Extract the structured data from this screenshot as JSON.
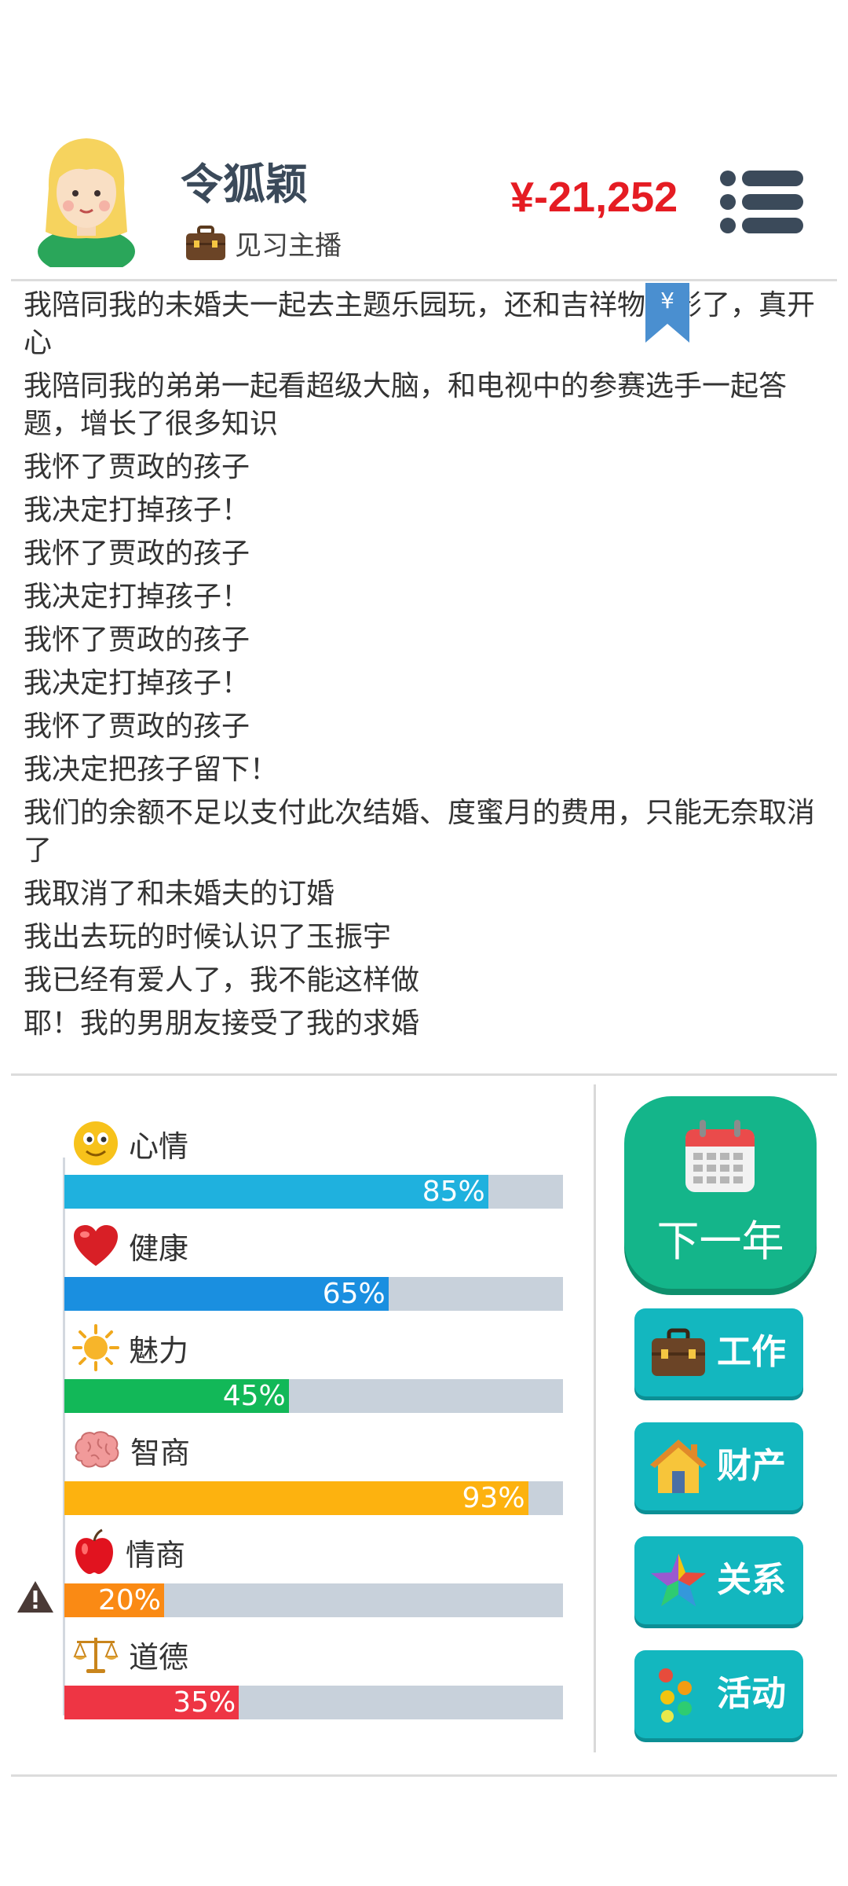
{
  "header": {
    "name": "令狐颖",
    "job": "见习主播",
    "money": "¥-21,252"
  },
  "log": [
    "我陪同我的未婚夫一起去主题乐园玩，还和吉祥物合影了，真开心",
    "我陪同我的弟弟一起看超级大脑，和电视中的参赛选手一起答题，增长了很多知识",
    "我怀了贾政的孩子",
    "我决定打掉孩子！",
    "我怀了贾政的孩子",
    "我决定打掉孩子！",
    "我怀了贾政的孩子",
    "我决定打掉孩子！",
    "我怀了贾政的孩子",
    "我决定把孩子留下！",
    "我们的余额不足以支付此次结婚、度蜜月的费用，只能无奈取消了",
    "我取消了和未婚夫的订婚",
    "我出去玩的时候认识了玉振宇",
    "我已经有爱人了，我不能这样做",
    "耶！我的男朋友接受了我的求婚"
  ],
  "bookmark_symbol": "¥",
  "stats": [
    {
      "label": "心情",
      "value": 85,
      "pct": "85%",
      "color": "#1fb1de",
      "icon": "smiley-icon"
    },
    {
      "label": "健康",
      "value": 65,
      "pct": "65%",
      "color": "#1a8fe0",
      "icon": "heart-icon"
    },
    {
      "label": "魅力",
      "value": 45,
      "pct": "45%",
      "color": "#12b858",
      "icon": "sun-icon"
    },
    {
      "label": "智商",
      "value": 93,
      "pct": "93%",
      "color": "#fdb20f",
      "icon": "brain-icon"
    },
    {
      "label": "情商",
      "value": 20,
      "pct": "20%",
      "color": "#fa8a14",
      "icon": "apple-icon",
      "warning": true
    },
    {
      "label": "道德",
      "value": 35,
      "pct": "35%",
      "color": "#ee3544",
      "icon": "scales-icon"
    }
  ],
  "actions": {
    "next_year": "下一年",
    "work": "工作",
    "assets": "财产",
    "relations": "关系",
    "activities": "活动"
  }
}
